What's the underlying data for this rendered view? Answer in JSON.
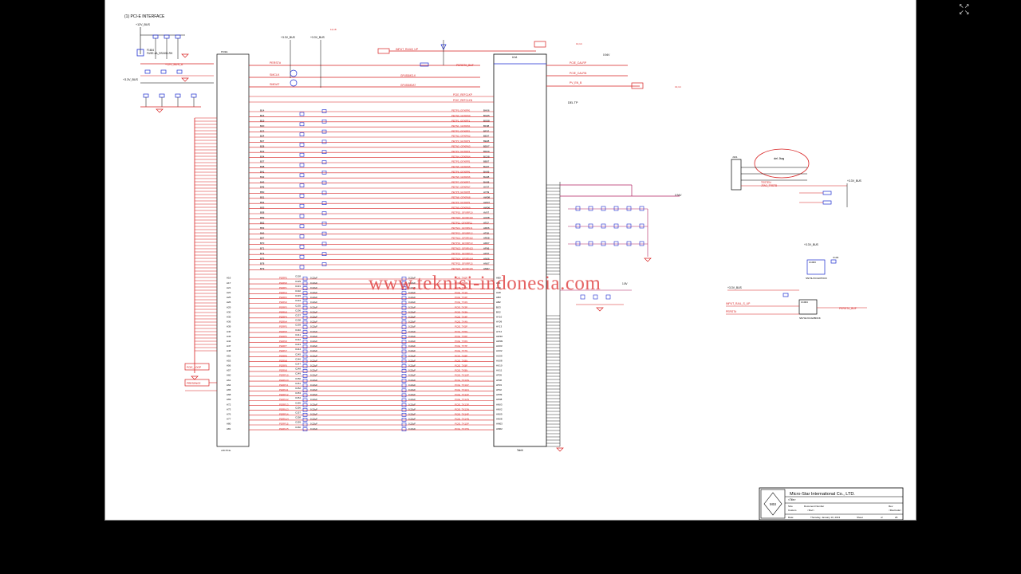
{
  "sheet_title": "(1) PCI-E INTERFACE",
  "watermark": "www.teknisi-indonesia.com",
  "company": "Micro-Star International Co., LTD.",
  "logo_text": "MSI",
  "title_block": {
    "title_field": "<Title>",
    "size_label": "Size",
    "size_value": "Custom",
    "doc_label": "Document Number",
    "doc_value": "<Doc>",
    "rev_label": "Rev",
    "rev_value": "<RevCode>",
    "date_label": "Date:",
    "date_value": "Thursday, January 10, 2013",
    "sheet_label": "Sheet",
    "of_label": "of",
    "sheet_total": "26"
  },
  "nets": {
    "v12_bus": "+12V_BUS",
    "v12_bus_a": "+12V_BUS_A",
    "v33_bus": "+3.3V_BUS",
    "v33_bus_2": "+3.3V_BUS",
    "v33_bus_3": "+3.3V_BUS",
    "perst": "PERST#",
    "smclk": "SMCLK",
    "smdat": "SMDAT",
    "gpu_smclk": "GPU53MCLK",
    "gpu_smdat": "GPU53MDAT",
    "input_rail": "INPUT_RAIL$_UP",
    "perst_buf": "PERST#_BUF",
    "pcie_clkp": "PCIE_CALRP",
    "pcie_clkn": "PCIE_CALRN",
    "pv_en": "PV_EN_B",
    "vref_094": "0.94V",
    "vref_1v8": "1.8V",
    "sheet_ref1": "13,14",
    "sheet_ref2": "13,14",
    "sheet_ref3": "12,18",
    "del_tp": "DEL TP",
    "jtag_note": "del Jtag",
    "jtag_trst": "TESTEN",
    "jtag_tck": "JTAG_TRSTB",
    "prsnt": "PRESENCE",
    "pwr_loop": "PCIE_LOOP",
    "input_rail2": "INPUT_RAIL_S_UP",
    "perst2": "PERST#",
    "perst_buf2": "PERST#_BUF"
  },
  "parts": {
    "fuse": "F1604",
    "fuse_desc": "FUSE-4A_SS2401-RH",
    "conn": "PCIE1",
    "conn_label": "x16 PCIe",
    "gpu": "U1A",
    "gpu_label": "Tahiti",
    "jtag_conn": "J101",
    "buf_ic": "U1003",
    "buf_ic_desc": "SN74LVC1G07DCK",
    "cap_ic": "C103",
    "q_ic": "U1004",
    "q_desc": "SN74LVC1G08DCK"
  },
  "lanes": [
    {
      "conn": "A16",
      "pn": "PERP0",
      "gpu": "PCIE_TX0P",
      "cap": "C128",
      "val": "0.22uF",
      "ball": "AB0"
    },
    {
      "conn": "A17",
      "pn": "PERN0",
      "gpu": "PCIE_TX0N",
      "cap": "C129",
      "val": "0.22uF",
      "ball": "AB1"
    },
    {
      "conn": "A21",
      "pn": "PERP1",
      "gpu": "PCIE_TX1P",
      "cap": "C131",
      "val": "0.22uF",
      "ball": "AA9"
    },
    {
      "conn": "A22",
      "pn": "PERN1",
      "gpu": "PCIE_TX1N",
      "cap": "C132",
      "val": "0.22uF",
      "ball": "AA8"
    },
    {
      "conn": "A25",
      "pn": "PERP2",
      "gpu": "PCIE_TX2P",
      "cap": "C133",
      "val": "0.22uF",
      "ball": "AB3"
    },
    {
      "conn": "A26",
      "pn": "PERN2",
      "gpu": "PCIE_TX2N",
      "cap": "C134",
      "val": "0.22uF",
      "ball": "AB2"
    },
    {
      "conn": "A29",
      "pn": "PERP3",
      "gpu": "PCIE_TX3P",
      "cap": "C135",
      "val": "0.22uF",
      "ball": "BS3"
    },
    {
      "conn": "A30",
      "pn": "PERN3",
      "gpu": "PCIE_TX3N",
      "cap": "C136",
      "val": "0.22uF",
      "ball": "BS2"
    },
    {
      "conn": "A35",
      "pn": "PERP4",
      "gpu": "PCIE_TX4P",
      "cap": "C137",
      "val": "0.22uF",
      "ball": "AY10"
    },
    {
      "conn": "A36",
      "pn": "PERN4",
      "gpu": "PCIE_TX4N",
      "cap": "C138",
      "val": "0.22uF",
      "ball": "AY09"
    },
    {
      "conn": "A39",
      "pn": "PERP5",
      "gpu": "PCIE_TX5P",
      "cap": "C139",
      "val": "0.22uF",
      "ball": "AY13"
    },
    {
      "conn": "A40",
      "pn": "PERN5",
      "gpu": "PCIE_TX5N",
      "cap": "C140",
      "val": "0.22uF",
      "ball": "AY12"
    },
    {
      "conn": "A43",
      "pn": "PERP6",
      "gpu": "PCIE_TX6P",
      "cap": "C141",
      "val": "0.22uF",
      "ball": "AW10"
    },
    {
      "conn": "A44",
      "pn": "PERN6",
      "gpu": "PCIE_TX6N",
      "cap": "C142",
      "val": "0.22uF",
      "ball": "AW09"
    },
    {
      "conn": "A47",
      "pn": "PERP7",
      "gpu": "PCIE_TX7P",
      "cap": "C143",
      "val": "0.22uF",
      "ball": "AU03"
    },
    {
      "conn": "A48",
      "pn": "PERN7",
      "gpu": "PCIE_TX7N",
      "cap": "C144",
      "val": "0.22uF",
      "ball": "AU02"
    },
    {
      "conn": "A52",
      "pn": "PERP8",
      "gpu": "PCIE_TX8P",
      "cap": "C145",
      "val": "0.22uF",
      "ball": "AU09"
    },
    {
      "conn": "A53",
      "pn": "PERN8",
      "gpu": "PCIE_TX8N",
      "cap": "C146",
      "val": "0.22uF",
      "ball": "AU08"
    },
    {
      "conn": "A56",
      "pn": "PERP9",
      "gpu": "PCIE_TX9P",
      "cap": "C147",
      "val": "0.22uF",
      "ball": "AU10"
    },
    {
      "conn": "A57",
      "pn": "PERN9",
      "gpu": "PCIE_TX9N",
      "cap": "C148",
      "val": "0.22uF",
      "ball": "AU11"
    },
    {
      "conn": "A60",
      "pn": "PERP10",
      "gpu": "PCIE_TX10P",
      "cap": "C149",
      "val": "0.22uF",
      "ball": "AT09"
    },
    {
      "conn": "A61",
      "pn": "PERN10",
      "gpu": "PCIE_TX10N",
      "cap": "C150",
      "val": "0.22uF",
      "ball": "AT08"
    },
    {
      "conn": "A64",
      "pn": "PERP11",
      "gpu": "PCIE_TX11P",
      "cap": "C151",
      "val": "0.22uF",
      "ball": "AT03"
    },
    {
      "conn": "A65",
      "pn": "PERN11",
      "gpu": "PCIE_TX11N",
      "cap": "C152",
      "val": "0.22uF",
      "ball": "AT02"
    },
    {
      "conn": "A68",
      "pn": "PERP12",
      "gpu": "PCIE_TX12P",
      "cap": "C153",
      "val": "0.22uF",
      "ball": "AP09"
    },
    {
      "conn": "A69",
      "pn": "PERN12",
      "gpu": "PCIE_TX12N",
      "cap": "C154",
      "val": "0.22uF",
      "ball": "AP08"
    },
    {
      "conn": "A72",
      "pn": "PERP13",
      "gpu": "PCIE_TX13P",
      "cap": "C155",
      "val": "0.22uF",
      "ball": "AN03"
    },
    {
      "conn": "A73",
      "pn": "PERN13",
      "gpu": "PCIE_TX13N",
      "cap": "C156",
      "val": "0.22uF",
      "ball": "AN02"
    },
    {
      "conn": "A76",
      "pn": "PERP14",
      "gpu": "PCIE_TX14P",
      "cap": "C157",
      "val": "0.22uF",
      "ball": "AN09"
    },
    {
      "conn": "A77",
      "pn": "PERN14",
      "gpu": "PCIE_TX14N",
      "cap": "C158",
      "val": "0.22uF",
      "ball": "AN08"
    },
    {
      "conn": "A80",
      "pn": "PERP15",
      "gpu": "PCIE_TX15P",
      "cap": "C159",
      "val": "0.22uF",
      "ball": "AM03"
    },
    {
      "conn": "A81",
      "pn": "PERN15",
      "gpu": "PCIE_TX15N",
      "cap": "C160",
      "val": "0.22uF",
      "ball": "AM02"
    }
  ],
  "rx_lanes": [
    {
      "conn": "B14",
      "gpu": "PETP0_GFXRP0",
      "ball": "BH06"
    },
    {
      "conn": "B15",
      "gpu": "PETN0_GFXRN0",
      "ball": "BG05"
    },
    {
      "conn": "B19",
      "gpu": "PETP1_GFXRP1",
      "ball": "BG08"
    },
    {
      "conn": "B20",
      "gpu": "PETN1_GFXRN1",
      "ball": "BF08"
    },
    {
      "conn": "B23",
      "gpu": "PETP2_GFXRP2",
      "ball": "BF07"
    },
    {
      "conn": "B24",
      "gpu": "PETN2_GFXRN2",
      "ball": "BE07"
    },
    {
      "conn": "B27",
      "gpu": "PETP3_GFXRP3",
      "ball": "BE08"
    },
    {
      "conn": "B28",
      "gpu": "PETN3_GFXRN3",
      "ball": "BD07"
    },
    {
      "conn": "B33",
      "gpu": "PETP4_GFXRP4",
      "ball": "BD09"
    },
    {
      "conn": "B34",
      "gpu": "PETN4_GFXRN4",
      "ball": "BC08"
    },
    {
      "conn": "B37",
      "gpu": "PETP5_GFXRP5",
      "ball": "BB07"
    },
    {
      "conn": "B38",
      "gpu": "PETN5_GFXRN5",
      "ball": "BA07"
    },
    {
      "conn": "B41",
      "gpu": "PETP6_GFXRP6",
      "ball": "BA09"
    },
    {
      "conn": "B42",
      "gpu": "PETN6_GFXRN6",
      "ball": "BA08"
    },
    {
      "conn": "B45",
      "gpu": "PETP7_GFXRP7",
      "ball": "BA08"
    },
    {
      "conn": "B46",
      "gpu": "PETN7_GFXRN7",
      "ball": "AY07"
    },
    {
      "conn": "B50",
      "gpu": "PETP8_GFXRP8",
      "ball": "AY09"
    },
    {
      "conn": "B51",
      "gpu": "PETN8_GFXRN8",
      "ball": "AW08"
    },
    {
      "conn": "B54",
      "gpu": "PETP9_GFXRP9",
      "ball": "AW07"
    },
    {
      "conn": "B55",
      "gpu": "PETN9_GFXRN9",
      "ball": "AW06"
    },
    {
      "conn": "B58",
      "gpu": "PETP10_GFXRP10",
      "ball": "AV07"
    },
    {
      "conn": "B59",
      "gpu": "PETN10_GFXRN10",
      "ball": "AU08"
    },
    {
      "conn": "B62",
      "gpu": "PETP11_GFXRP11",
      "ball": "AT07"
    },
    {
      "conn": "B63",
      "gpu": "PETN11_GFXRN11",
      "ball": "AR06"
    },
    {
      "conn": "B66",
      "gpu": "PETP12_GFXRP12",
      "ball": "AT08"
    },
    {
      "conn": "B67",
      "gpu": "PETN12_GFXRN12",
      "ball": "AR08"
    },
    {
      "conn": "B70",
      "gpu": "PETP13_GFXRP13",
      "ball": "AR07"
    },
    {
      "conn": "B71",
      "gpu": "PETN13_GFXRN13",
      "ball": "AP06"
    },
    {
      "conn": "B74",
      "gpu": "PETP14_GFXRP14",
      "ball": "AP07"
    },
    {
      "conn": "B75",
      "gpu": "PETN14_GFXRN14",
      "ball": "AN06"
    },
    {
      "conn": "B78",
      "gpu": "PETP15_GFXRP15",
      "ball": "AN07"
    },
    {
      "conn": "B79",
      "gpu": "PETN15_GFXRN15",
      "ball": "AM07"
    }
  ],
  "refclk": {
    "p": "PCIE_REFCLKP",
    "n": "PCIE_REFCLKN",
    "ball_p": "BE53",
    "ball_n": "BE52"
  }
}
